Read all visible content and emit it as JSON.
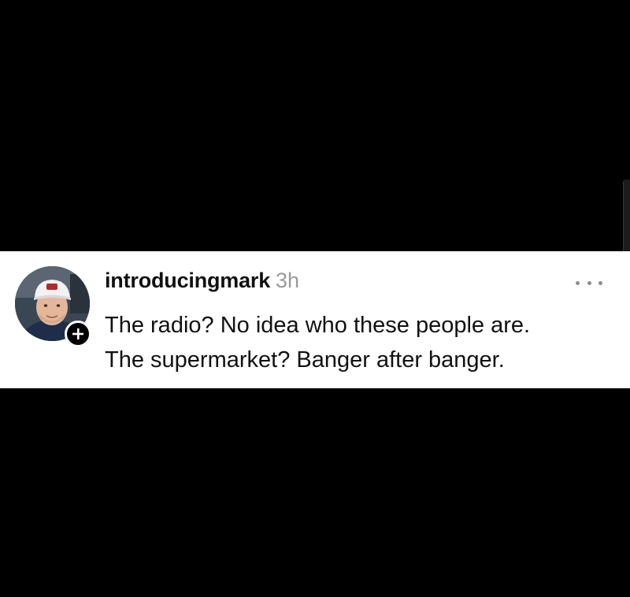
{
  "post": {
    "username": "introducingmark",
    "timestamp": "3h",
    "text_lines": [
      "The radio? No idea who these people are.",
      "The supermarket? Banger after banger."
    ],
    "more_icon": "more-horizontal-icon",
    "follow_icon": "plus-icon"
  },
  "colors": {
    "background": "#000000",
    "card": "#ffffff",
    "username": "#111111",
    "timestamp": "#9a9a9a"
  }
}
